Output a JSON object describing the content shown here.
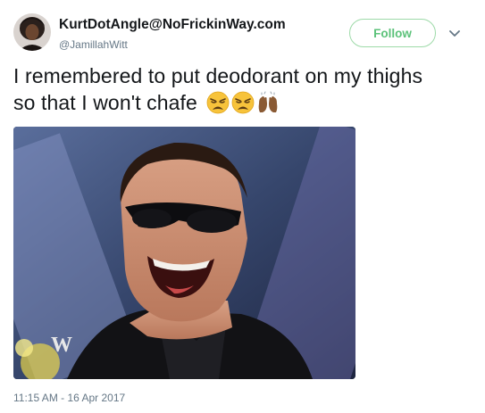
{
  "user": {
    "display_name": "KurtDotAngle@NoFrickinWay.com",
    "handle": "@JamillahWitt",
    "avatar_icon": "avatar-photo"
  },
  "actions": {
    "follow_label": "Follow",
    "menu_icon": "chevron-down-icon"
  },
  "tweet": {
    "text_line1": "I remembered to put deodorant on my thighs",
    "text_line2": "so that I won't chafe",
    "emojis": [
      "weary-face",
      "weary-face",
      "raising-hands"
    ],
    "media_logo": "W",
    "timestamp": "11:15 AM - 16 Apr 2017"
  },
  "colors": {
    "follow_accent": "#5cc27a",
    "secondary_text": "#657786"
  }
}
